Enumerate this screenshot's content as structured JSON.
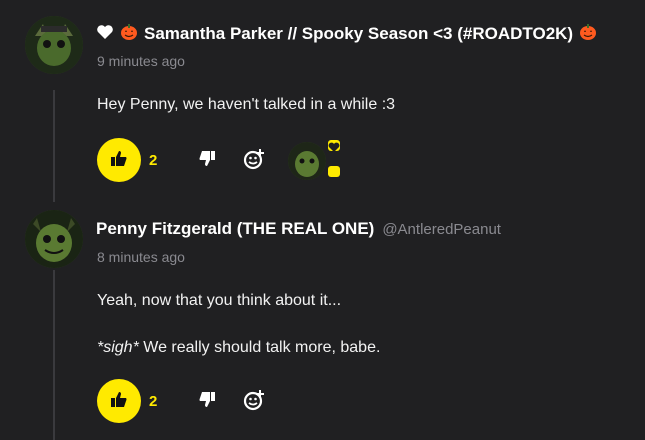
{
  "comments": [
    {
      "name": "Samantha Parker // Spooky Season <3 (#ROADTO2K)",
      "time": "9 minutes ago",
      "lines": [
        "Hey Penny, we haven't talked in a while :3"
      ],
      "likes": "2",
      "icons": {
        "heart": "heart-icon",
        "pumpkin": "pumpkin-icon"
      }
    },
    {
      "name": "Penny Fitzgerald (THE REAL ONE)",
      "handle": "@AntleredPeanut",
      "time": "8 minutes ago",
      "line1": "Yeah, now that you think about it...",
      "line2_em": "*sigh*",
      "line2_rest": " We really should talk more, babe.",
      "likes": "2"
    }
  ],
  "colors": {
    "accent": "#ffea00",
    "background": "#202022",
    "muted": "#8a8a90"
  }
}
